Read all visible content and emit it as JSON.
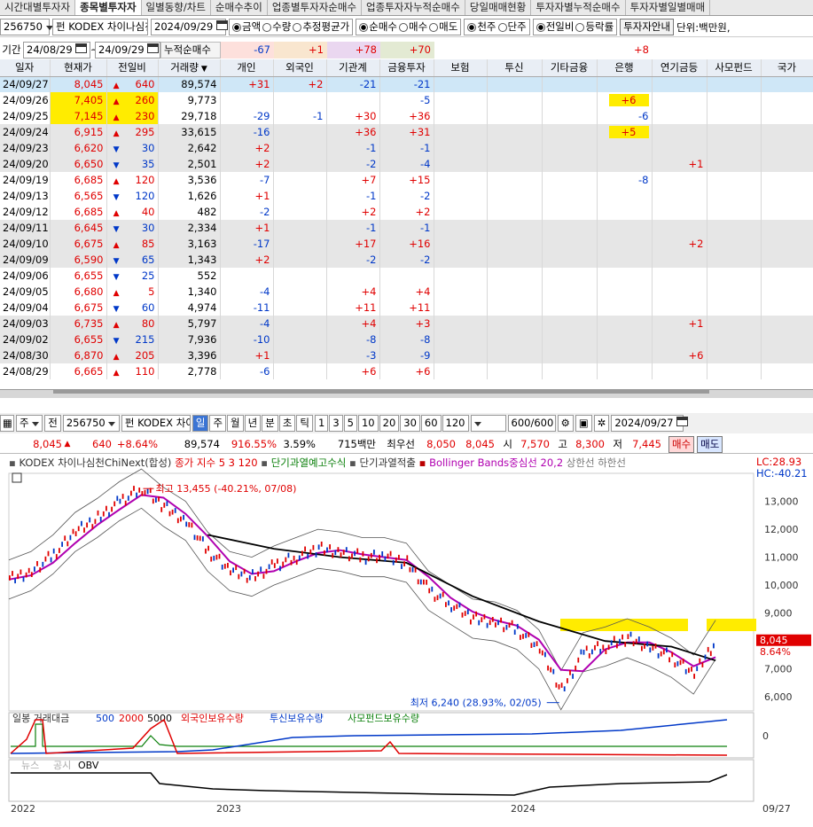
{
  "tabs": [
    "시간대별투자자",
    "종목별투자자",
    "일별동향/차트",
    "순매수추이",
    "업종별투자자순매수",
    "업종투자자누적순매수",
    "당일매매현황",
    "투자자별누적순매수",
    "투자자별일별매매"
  ],
  "active_tab": 1,
  "top": {
    "code": "256750",
    "fund_label": "펀",
    "name": "KODEX 차이나심천",
    "date": "2024/09/29",
    "radio_group1": [
      "금액",
      "수량",
      "추정평균가"
    ],
    "radio_group2": [
      "순매수",
      "매수",
      "매도"
    ],
    "radio_group3": [
      "천주",
      "단주"
    ],
    "radio_group4": [
      "전일비",
      "등락률"
    ],
    "guide_btn": "투자자안내",
    "unit": "단위:백만원,"
  },
  "period": {
    "label": "기간",
    "from": "24/08/29",
    "to": "24/09/29",
    "cum_label": "누적순매수",
    "sums": [
      "-67",
      "+1",
      "+78",
      "+70",
      "",
      "",
      "",
      "+8",
      "",
      ""
    ]
  },
  "columns": [
    "일자",
    "현재가",
    "전일비",
    "거래량",
    "개인",
    "외국인",
    "기관계",
    "금융투자",
    "보험",
    "투신",
    "기타금융",
    "은행",
    "연기금등",
    "사모펀드",
    "국가"
  ],
  "rows": [
    {
      "date": "24/09/27",
      "price": "8,045",
      "dir": "up",
      "chg": "640",
      "vol": "89,574",
      "ind": "+31",
      "frn": "+2",
      "inst": "-21",
      "fin": "-21",
      "bank": "",
      "pen": ""
    },
    {
      "date": "24/09/26",
      "price": "7,405",
      "dir": "up",
      "chg": "260",
      "vol": "9,773",
      "ind": "",
      "frn": "",
      "inst": "",
      "fin": "-5",
      "bank": "+6",
      "pen": ""
    },
    {
      "date": "24/09/25",
      "price": "7,145",
      "dir": "up",
      "chg": "230",
      "vol": "29,718",
      "ind": "-29",
      "frn": "-1",
      "inst": "+30",
      "fin": "+36",
      "bank": "-6",
      "pen": ""
    },
    {
      "date": "24/09/24",
      "price": "6,915",
      "dir": "up",
      "chg": "295",
      "vol": "33,615",
      "ind": "-16",
      "frn": "",
      "inst": "+36",
      "fin": "+31",
      "bank": "+5",
      "pen": ""
    },
    {
      "date": "24/09/23",
      "price": "6,620",
      "dir": "dn",
      "chg": "30",
      "vol": "2,642",
      "ind": "+2",
      "frn": "",
      "inst": "-1",
      "fin": "-1",
      "bank": "",
      "pen": ""
    },
    {
      "date": "24/09/20",
      "price": "6,650",
      "dir": "dn",
      "chg": "35",
      "vol": "2,501",
      "ind": "+2",
      "frn": "",
      "inst": "-2",
      "fin": "-4",
      "bank": "",
      "pen": "+1"
    },
    {
      "date": "24/09/19",
      "price": "6,685",
      "dir": "up",
      "chg": "120",
      "vol": "3,536",
      "ind": "-7",
      "frn": "",
      "inst": "+7",
      "fin": "+15",
      "bank": "-8",
      "pen": ""
    },
    {
      "date": "24/09/13",
      "price": "6,565",
      "dir": "dn",
      "chg": "120",
      "vol": "1,626",
      "ind": "+1",
      "frn": "",
      "inst": "-1",
      "fin": "-2",
      "bank": "",
      "pen": ""
    },
    {
      "date": "24/09/12",
      "price": "6,685",
      "dir": "up",
      "chg": "40",
      "vol": "482",
      "ind": "-2",
      "frn": "",
      "inst": "+2",
      "fin": "+2",
      "bank": "",
      "pen": ""
    },
    {
      "date": "24/09/11",
      "price": "6,645",
      "dir": "dn",
      "chg": "30",
      "vol": "2,334",
      "ind": "+1",
      "frn": "",
      "inst": "-1",
      "fin": "-1",
      "bank": "",
      "pen": ""
    },
    {
      "date": "24/09/10",
      "price": "6,675",
      "dir": "up",
      "chg": "85",
      "vol": "3,163",
      "ind": "-17",
      "frn": "",
      "inst": "+17",
      "fin": "+16",
      "bank": "",
      "pen": "+2"
    },
    {
      "date": "24/09/09",
      "price": "6,590",
      "dir": "dn",
      "chg": "65",
      "vol": "1,343",
      "ind": "+2",
      "frn": "",
      "inst": "-2",
      "fin": "-2",
      "bank": "",
      "pen": ""
    },
    {
      "date": "24/09/06",
      "price": "6,655",
      "dir": "dn",
      "chg": "25",
      "vol": "552",
      "ind": "",
      "frn": "",
      "inst": "",
      "fin": "",
      "bank": "",
      "pen": ""
    },
    {
      "date": "24/09/05",
      "price": "6,680",
      "dir": "up",
      "chg": "5",
      "vol": "1,340",
      "ind": "-4",
      "frn": "",
      "inst": "+4",
      "fin": "+4",
      "bank": "",
      "pen": ""
    },
    {
      "date": "24/09/04",
      "price": "6,675",
      "dir": "dn",
      "chg": "60",
      "vol": "4,974",
      "ind": "-11",
      "frn": "",
      "inst": "+11",
      "fin": "+11",
      "bank": "",
      "pen": ""
    },
    {
      "date": "24/09/03",
      "price": "6,735",
      "dir": "up",
      "chg": "80",
      "vol": "5,797",
      "ind": "-4",
      "frn": "",
      "inst": "+4",
      "fin": "+3",
      "bank": "",
      "pen": "+1"
    },
    {
      "date": "24/09/02",
      "price": "6,655",
      "dir": "dn",
      "chg": "215",
      "vol": "7,936",
      "ind": "-10",
      "frn": "",
      "inst": "-8",
      "fin": "-8",
      "bank": "",
      "pen": ""
    },
    {
      "date": "24/08/30",
      "price": "6,870",
      "dir": "up",
      "chg": "205",
      "vol": "3,396",
      "ind": "+1",
      "frn": "",
      "inst": "-3",
      "fin": "-9",
      "bank": "",
      "pen": "+6"
    },
    {
      "date": "24/08/29",
      "price": "6,665",
      "dir": "up",
      "chg": "110",
      "vol": "2,778",
      "ind": "-6",
      "frn": "",
      "inst": "+6",
      "fin": "+6",
      "bank": "",
      "pen": ""
    }
  ],
  "chart_toolbar": {
    "prefix": "주",
    "prev": "전",
    "code": "256750",
    "name": "KODEX 차이",
    "periods": [
      "일",
      "주",
      "월",
      "년",
      "분",
      "초",
      "틱"
    ],
    "active_period": "일",
    "mins": [
      "1",
      "3",
      "5",
      "10",
      "20",
      "30",
      "60",
      "120"
    ],
    "count": "600",
    "count_total": "/600",
    "date": "2024/09/27"
  },
  "quote": {
    "price": "8,045",
    "chg": "640",
    "pct": "+8.64%",
    "vol": "89,574",
    "vol_ratio": "916.55%",
    "turnover": "3.59%",
    "amount": "715백만",
    "bid_label": "최우선",
    "bid": "8,050",
    "ask": "8,045",
    "open_label": "시",
    "open": "7,570",
    "high_label": "고",
    "high": "8,300",
    "low_label": "저",
    "low": "7,445",
    "buy": "매수",
    "sell": "매도"
  },
  "chart_legend": {
    "name": "KODEX 차이나심천ChiNext(합성)",
    "ma": "종가 지수 5  3  120",
    "s1": "단기과열예고수식",
    "s2": "단기과열적출",
    "bb": "Bollinger Bands중심선 20,2",
    "bb2": "상한선  하한선",
    "lc": "LC:28.93",
    "hc": "HC:-40.21"
  },
  "annotations": {
    "high": "최고 13,455 (-40.21%, 07/08)",
    "low": "최저 6,240 (28.93%, 02/05)",
    "last_price": "8,045",
    "last_pct": "8.64%"
  },
  "sub1_legend": {
    "a": "일봉 거래대금",
    "b": "500",
    "c": "2000",
    "d": "5000",
    "e": "외국인보유수량",
    "f": "투신보유수량",
    "g": "사모펀드보유수량"
  },
  "sub2_legend": {
    "a": "뉴스",
    "b": "공시",
    "c": "OBV"
  },
  "sub1_zero": "0",
  "x_labels": [
    "2022",
    "2023",
    "2024",
    "09/27"
  ],
  "chart_data": {
    "type": "line",
    "title": "KODEX 차이나심천ChiNext(합성)",
    "y_ticks": [
      13000,
      12000,
      11000,
      10000,
      9000,
      8000,
      7000,
      6000
    ],
    "ylim": [
      5500,
      14000
    ],
    "x_ticks": [
      "2022",
      "2023",
      "2024",
      "09/27"
    ],
    "price_series": [
      {
        "x": "2022-01",
        "y": 10200
      },
      {
        "x": "2022-02",
        "y": 10500
      },
      {
        "x": "2022-03",
        "y": 11100
      },
      {
        "x": "2022-04",
        "y": 11900
      },
      {
        "x": "2022-05",
        "y": 12400
      },
      {
        "x": "2022-06",
        "y": 13000
      },
      {
        "x": "2022-07",
        "y": 13455
      },
      {
        "x": "2022-08",
        "y": 12800
      },
      {
        "x": "2022-09",
        "y": 12300
      },
      {
        "x": "2022-10",
        "y": 11200
      },
      {
        "x": "2022-11",
        "y": 10500
      },
      {
        "x": "2022-12",
        "y": 10300
      },
      {
        "x": "2023-01",
        "y": 10700
      },
      {
        "x": "2023-02",
        "y": 11000
      },
      {
        "x": "2023-03",
        "y": 11300
      },
      {
        "x": "2023-04",
        "y": 11200
      },
      {
        "x": "2023-05",
        "y": 11000
      },
      {
        "x": "2023-06",
        "y": 11000
      },
      {
        "x": "2023-07",
        "y": 10800
      },
      {
        "x": "2023-08",
        "y": 9800
      },
      {
        "x": "2023-09",
        "y": 9300
      },
      {
        "x": "2023-10",
        "y": 8800
      },
      {
        "x": "2023-11",
        "y": 8700
      },
      {
        "x": "2023-12",
        "y": 8400
      },
      {
        "x": "2024-01",
        "y": 7700
      },
      {
        "x": "2024-02",
        "y": 6240
      },
      {
        "x": "2024-03",
        "y": 7600
      },
      {
        "x": "2024-04",
        "y": 7800
      },
      {
        "x": "2024-05",
        "y": 8100
      },
      {
        "x": "2024-06",
        "y": 7800
      },
      {
        "x": "2024-07",
        "y": 7400
      },
      {
        "x": "2024-08",
        "y": 6800
      },
      {
        "x": "2024-09",
        "y": 8045
      }
    ],
    "ma120_series": [
      {
        "x": "2022-10",
        "y": 11800
      },
      {
        "x": "2023-01",
        "y": 11300
      },
      {
        "x": "2023-04",
        "y": 11000
      },
      {
        "x": "2023-07",
        "y": 10800
      },
      {
        "x": "2023-10",
        "y": 9600
      },
      {
        "x": "2024-01",
        "y": 8700
      },
      {
        "x": "2024-04",
        "y": 8000
      },
      {
        "x": "2024-07",
        "y": 7800
      },
      {
        "x": "2024-09",
        "y": 7300
      }
    ]
  }
}
